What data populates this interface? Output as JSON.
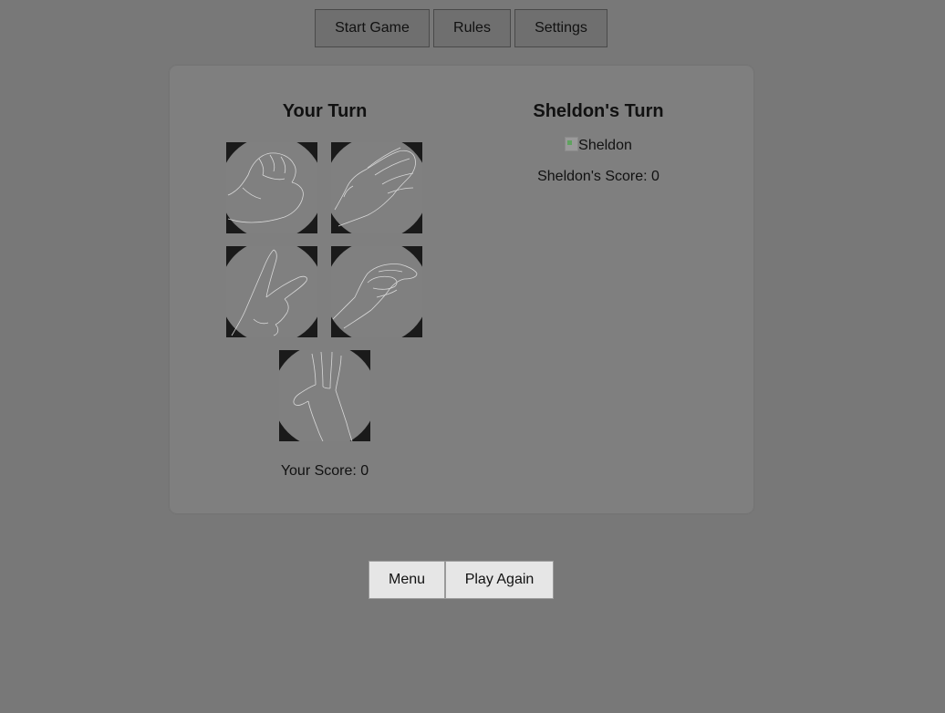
{
  "nav": {
    "start_label": "Start Game",
    "rules_label": "Rules",
    "settings_label": "Settings"
  },
  "player": {
    "title": "Your Turn",
    "score_label": "Your Score: 0",
    "choices": [
      {
        "name": "rock",
        "icon": "rock-hand-icon"
      },
      {
        "name": "paper",
        "icon": "paper-hand-icon"
      },
      {
        "name": "scissors",
        "icon": "scissors-hand-icon"
      },
      {
        "name": "lizard",
        "icon": "lizard-hand-icon"
      },
      {
        "name": "spock",
        "icon": "spock-hand-icon"
      }
    ]
  },
  "opponent": {
    "title": "Sheldon's Turn",
    "image_alt": "Sheldon",
    "score_label": "Sheldon's Score: 0"
  },
  "footer": {
    "menu_label": "Menu",
    "play_again_label": "Play Again"
  },
  "colors": {
    "page_background": "#787878",
    "panel_background": "#7f7f7f",
    "tile_corner": "#1a1a1a",
    "tile_face": "#808080"
  }
}
